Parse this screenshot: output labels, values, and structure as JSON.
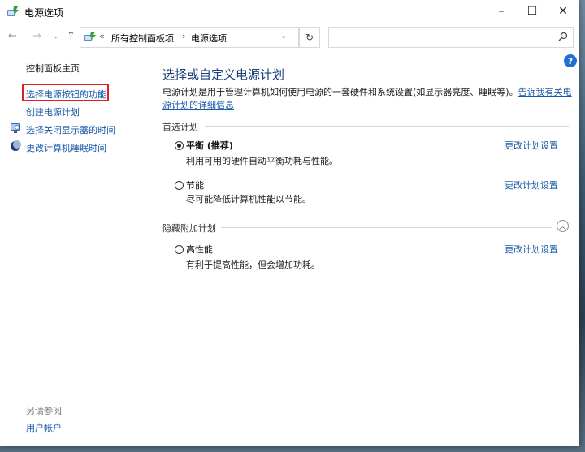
{
  "window": {
    "title": "电源选项",
    "controls": {
      "minimize": "–",
      "maximize": "☐",
      "close": "✕"
    }
  },
  "address": {
    "back": "←",
    "forward": "→",
    "history": "⌄",
    "up": "↑",
    "sep": "«",
    "crumbs": [
      "所有控制面板项",
      "电源选项"
    ],
    "crumb_sep": "›",
    "dropdown": "⌄",
    "refresh": "↻",
    "search_placeholder": ""
  },
  "sidebar": {
    "home": "控制面板主页",
    "items": [
      {
        "label": "选择电源按钮的功能",
        "highlighted": true
      },
      {
        "label": "创建电源计划"
      },
      {
        "label": "选择关闭显示器的时间",
        "icon": "monitor-icon"
      },
      {
        "label": "更改计算机睡眠时间",
        "icon": "moon-icon"
      }
    ],
    "see_also": "另请参阅",
    "user_accounts": "用户帐户"
  },
  "main": {
    "help": "?",
    "title": "选择或自定义电源计划",
    "description": "电源计划是用于管理计算机如何使用电源的一套硬件和系统设置(如显示器亮度、睡眠等)。",
    "description_link": "告诉我有关电源计划的详细信息",
    "preferred_header": "首选计划",
    "hidden_header": "隐藏附加计划",
    "collapse_glyph": "︿",
    "plans": [
      {
        "name": "平衡 (推荐)",
        "desc": "利用可用的硬件自动平衡功耗与性能。",
        "link": "更改计划设置",
        "selected": true
      },
      {
        "name": "节能",
        "desc": "尽可能降低计算机性能以节能。",
        "link": "更改计划设置",
        "selected": false
      }
    ],
    "hidden_plans": [
      {
        "name": "高性能",
        "desc": "有利于提高性能，但会增加功耗。",
        "link": "更改计划设置",
        "selected": false
      }
    ]
  },
  "colors": {
    "link": "#1a5aa8",
    "title": "#1a3f7a",
    "highlight_border": "#e02020"
  }
}
